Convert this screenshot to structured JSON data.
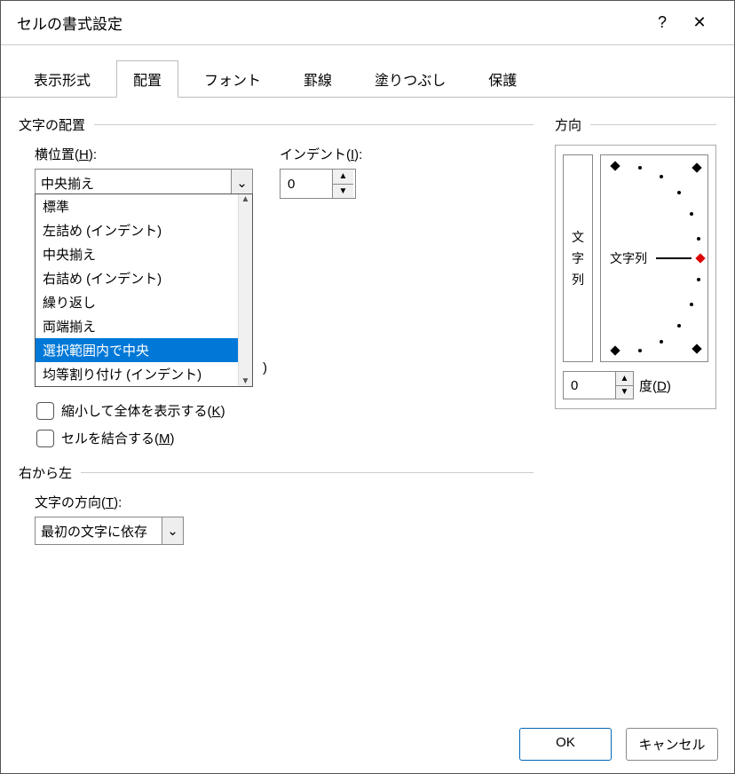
{
  "title": "セルの書式設定",
  "titlebar": {
    "help": "?",
    "close": "✕"
  },
  "tabs": [
    "表示形式",
    "配置",
    "フォント",
    "罫線",
    "塗りつぶし",
    "保護"
  ],
  "active_tab": 1,
  "alignment": {
    "group_label": "文字の配置",
    "horizontal_label_pre": "横位置(",
    "horizontal_key": "H",
    "horizontal_label_post": "):",
    "horizontal_value": "中央揃え",
    "horizontal_options": [
      "標準",
      "左詰め (インデント)",
      "中央揃え",
      "右詰め (インデント)",
      "繰り返し",
      "両端揃え",
      "選択範囲内で中央",
      "均等割り付け (インデント)"
    ],
    "horizontal_selected_index": 6,
    "indent_label_pre": "インデント(",
    "indent_key": "I",
    "indent_label_post": "):",
    "indent_value": "0"
  },
  "textcontrol": {
    "partial_visible": ")",
    "shrink_pre": "縮小して全体を表示する(",
    "shrink_key": "K",
    "shrink_post": ")",
    "merge_pre": "セルを結合する(",
    "merge_key": "M",
    "merge_post": ")"
  },
  "rtl": {
    "group_label": "右から左",
    "dir_label_pre": "文字の方向(",
    "dir_key": "T",
    "dir_label_post": "):",
    "dir_value": "最初の文字に依存"
  },
  "orientation": {
    "group_label": "方向",
    "vertical_text": [
      "文",
      "字",
      "列"
    ],
    "dial_label": "文字列",
    "deg_value": "0",
    "deg_label_pre": "度(",
    "deg_key": "D",
    "deg_label_post": ")"
  },
  "footer": {
    "ok": "OK",
    "cancel": "キャンセル"
  }
}
